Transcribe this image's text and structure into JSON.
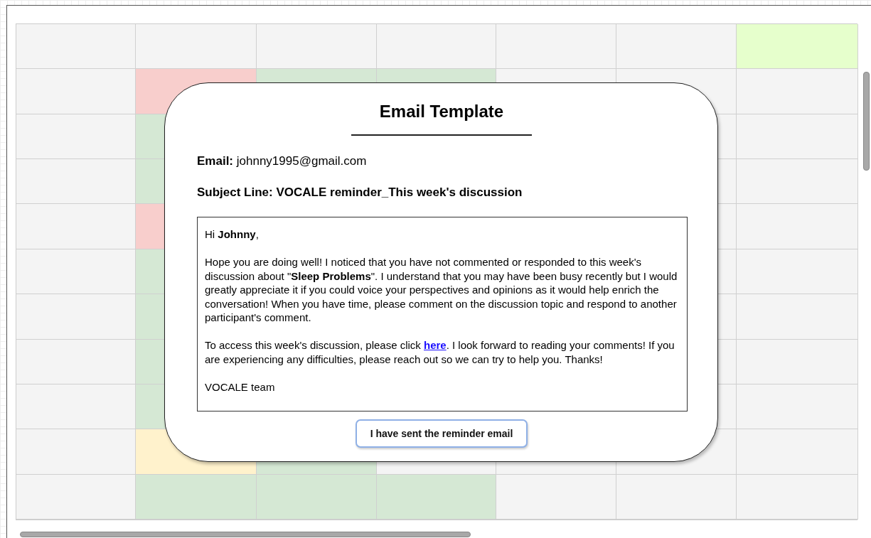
{
  "grid": {
    "rows": [
      {
        "cells": [
          {
            "color": "#f4f4f4"
          },
          {
            "color": "#f4f4f4"
          },
          {
            "color": "#f4f4f4"
          },
          {
            "color": "#f4f4f4"
          },
          {
            "color": "#f4f4f4"
          },
          {
            "color": "#f4f4f4"
          },
          {
            "color": "#e6ffcc"
          }
        ]
      },
      {
        "cells": [
          {
            "color": "#f4f4f4"
          },
          {
            "color": "#f8cecc"
          },
          {
            "color": "#d5e8d4"
          },
          {
            "color": "#d5e8d4"
          },
          {
            "color": "#f4f4f4"
          },
          {
            "color": "#f4f4f4"
          },
          {
            "color": "#f4f4f4"
          }
        ]
      },
      {
        "cells": [
          {
            "color": "#f4f4f4"
          },
          {
            "color": "#d5e8d4"
          },
          {},
          {},
          {},
          {
            "color": "#f4f4f4"
          },
          {
            "color": "#f4f4f4"
          }
        ]
      },
      {
        "cells": [
          {
            "color": "#f4f4f4"
          },
          {
            "color": "#d5e8d4"
          },
          {},
          {},
          {},
          {
            "color": "#f4f4f4"
          },
          {
            "color": "#f4f4f4"
          }
        ]
      },
      {
        "cells": [
          {
            "color": "#f4f4f4"
          },
          {
            "color": "#f8cecc"
          },
          {},
          {},
          {},
          {
            "color": "#f4f4f4"
          },
          {
            "color": "#f4f4f4"
          }
        ]
      },
      {
        "cells": [
          {
            "color": "#f4f4f4"
          },
          {
            "color": "#d5e8d4"
          },
          {},
          {},
          {},
          {
            "color": "#f4f4f4"
          },
          {
            "color": "#f4f4f4"
          }
        ]
      },
      {
        "cells": [
          {
            "color": "#f4f4f4"
          },
          {
            "color": "#d5e8d4"
          },
          {},
          {},
          {},
          {
            "color": "#f4f4f4"
          },
          {
            "color": "#f4f4f4"
          }
        ]
      },
      {
        "cells": [
          {
            "color": "#f4f4f4"
          },
          {
            "color": "#d5e8d4"
          },
          {},
          {},
          {},
          {
            "color": "#f4f4f4"
          },
          {
            "color": "#f4f4f4"
          }
        ]
      },
      {
        "cells": [
          {
            "color": "#f4f4f4"
          },
          {
            "color": "#d5e8d4"
          },
          {},
          {},
          {},
          {
            "color": "#f4f4f4"
          },
          {
            "color": "#f4f4f4"
          }
        ]
      },
      {
        "cells": [
          {
            "color": "#f4f4f4"
          },
          {
            "color": "#fff2cc"
          },
          {
            "color": "#d5e8d4"
          },
          {
            "color": "#f4f4f4"
          },
          {
            "color": "#f4f4f4"
          },
          {
            "color": "#f4f4f4"
          },
          {
            "color": "#f4f4f4"
          }
        ]
      },
      {
        "cells": [
          {
            "color": "#f4f4f4"
          },
          {
            "color": "#d5e8d4"
          },
          {
            "color": "#d5e8d4"
          },
          {
            "color": "#d5e8d4"
          },
          {
            "color": "#f4f4f4"
          },
          {
            "color": "#f4f4f4"
          },
          {
            "color": "#f4f4f4"
          }
        ]
      }
    ]
  },
  "dialog": {
    "title": "Email Template",
    "email": "**Email:** johnny1995@gmail.com",
    "subject": "Subject Line: VOCALE reminder_This week's discussion",
    "message": {
      "greeting": "Hi **Johnny**,",
      "body": "Hope you are doing well! I noticed that you have not commented or responded to this week's discussion about \"**Sleep Problems**\". I understand that you may have been busy recently but I would greatly appreciate it if you could voice your perspectives and opinions as it would help enrich the conversation! When you have time, please comment on the discussion topic and respond to another participant's comment.",
      "access_before": "To access this week's discussion, please click",
      "link": "here",
      "access_after": ". I look forward to reading your comments! If you are experiencing any difficulties, please reach out so we can try to help you. Thanks!",
      "signature": "VOCALE team"
    },
    "button": "I have sent the reminder email"
  }
}
